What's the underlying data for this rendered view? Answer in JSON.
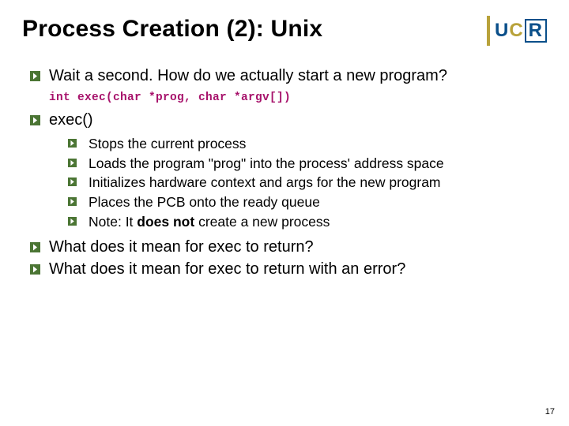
{
  "title": "Process Creation (2): Unix",
  "logo": {
    "u": "U",
    "c": "C",
    "r": "R"
  },
  "bullets": {
    "b1": "Wait a second.  How do we actually start a new program?",
    "code": "int exec(char *prog, char *argv[])",
    "b2": "exec()",
    "sub": {
      "s1": "Stops the current process",
      "s2_a": "Loads the program \"prog\" into the process' address space",
      "s3": "Initializes hardware context and args for the new program",
      "s4": "Places the PCB onto the ready queue",
      "s5_a": "Note: It ",
      "s5_b": "does not",
      "s5_c": " create a new process"
    },
    "b3": "What does it mean for exec to return?",
    "b4": "What does it mean for exec to return with an error?"
  },
  "pageNumber": "17"
}
